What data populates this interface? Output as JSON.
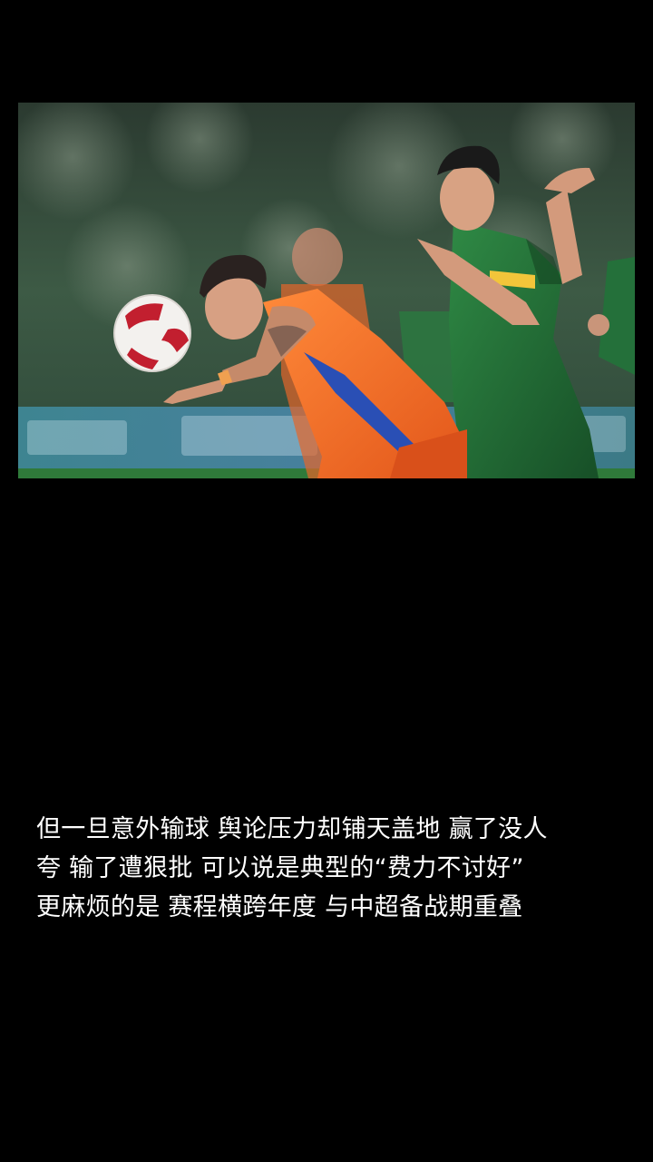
{
  "photo": {
    "subject": "football-match-photo"
  },
  "caption": {
    "lines": [
      "但一旦意外输球  舆论压力却铺天盖地  赢了没人",
      "夸  输了遭狠批  可以说是典型的“费力不讨好”",
      "更麻烦的是  赛程横跨年度  与中超备战期重叠"
    ]
  },
  "colors": {
    "background": "#000000",
    "text": "#ffffff",
    "orange_kit": "#f06a22",
    "green_kit": "#1f6b35",
    "pitch": "#2f7a3a"
  }
}
